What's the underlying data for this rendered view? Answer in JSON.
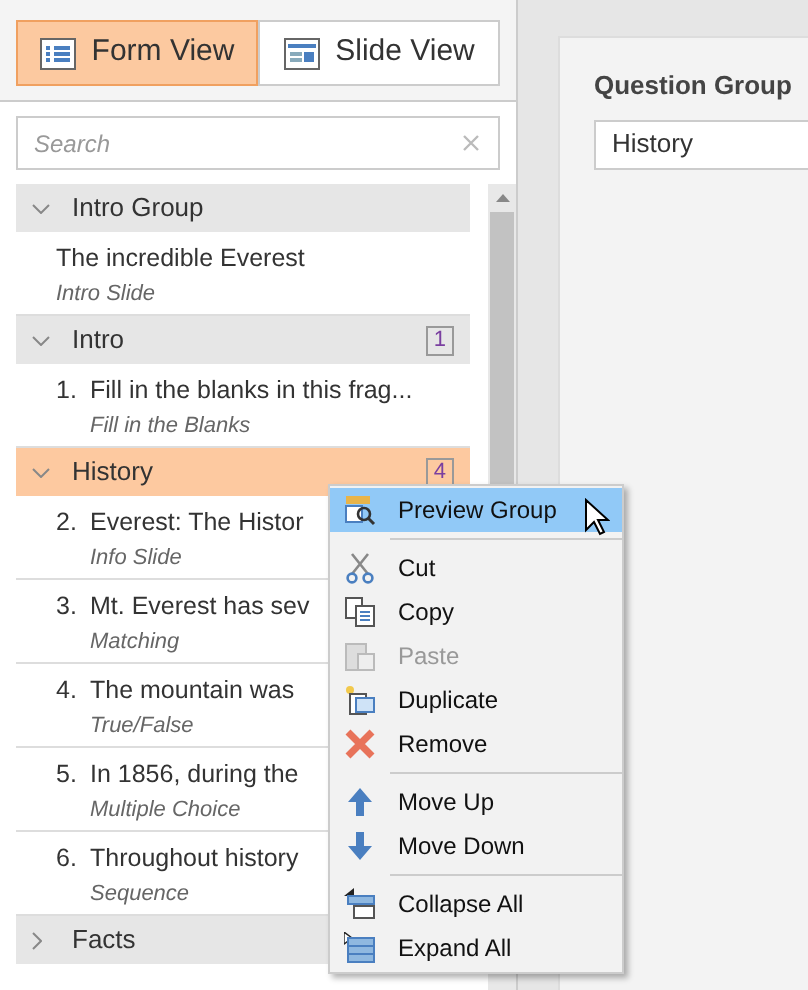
{
  "view_tabs": [
    {
      "label": "Form View",
      "selected": true
    },
    {
      "label": "Slide View",
      "selected": false
    }
  ],
  "search": {
    "placeholder": "Search"
  },
  "groups": [
    {
      "name": "Intro Group",
      "expanded": true,
      "selected": false,
      "items": [
        {
          "title": "The incredible Everest",
          "type": "Intro Slide"
        }
      ]
    },
    {
      "name": "Intro",
      "expanded": true,
      "selected": false,
      "count": "1",
      "items": [
        {
          "number": "1.",
          "title": "Fill in the blanks in this frag...",
          "type": "Fill in the Blanks"
        }
      ]
    },
    {
      "name": "History",
      "expanded": true,
      "selected": true,
      "count": "4",
      "items": [
        {
          "number": "2.",
          "title": "Everest: The Histor",
          "type": "Info Slide"
        },
        {
          "number": "3.",
          "title": "Mt. Everest has sev",
          "type": "Matching"
        },
        {
          "number": "4.",
          "title": "The mountain was",
          "type": "True/False"
        },
        {
          "number": "5.",
          "title": "In 1856, during the",
          "type": "Multiple Choice"
        },
        {
          "number": "6.",
          "title": "Throughout history",
          "type": "Sequence"
        }
      ]
    },
    {
      "name": "Facts",
      "expanded": false,
      "selected": false
    }
  ],
  "question_group": {
    "label": "Question Group",
    "value": "History"
  },
  "context_menu": [
    {
      "kind": "item",
      "label": "Preview Group",
      "selected": true,
      "disabled": false
    },
    {
      "kind": "separator"
    },
    {
      "kind": "item",
      "label": "Cut",
      "selected": false,
      "disabled": false
    },
    {
      "kind": "item",
      "label": "Copy",
      "selected": false,
      "disabled": false
    },
    {
      "kind": "item",
      "label": "Paste",
      "selected": false,
      "disabled": true
    },
    {
      "kind": "item",
      "label": "Duplicate",
      "selected": false,
      "disabled": false
    },
    {
      "kind": "item",
      "label": "Remove",
      "selected": false,
      "disabled": false
    },
    {
      "kind": "separator"
    },
    {
      "kind": "item",
      "label": "Move Up",
      "selected": false,
      "disabled": false
    },
    {
      "kind": "item",
      "label": "Move Down",
      "selected": false,
      "disabled": false
    },
    {
      "kind": "separator"
    },
    {
      "kind": "item",
      "label": "Collapse All",
      "selected": false,
      "disabled": false
    },
    {
      "kind": "item",
      "label": "Expand All",
      "selected": false,
      "disabled": false
    }
  ]
}
